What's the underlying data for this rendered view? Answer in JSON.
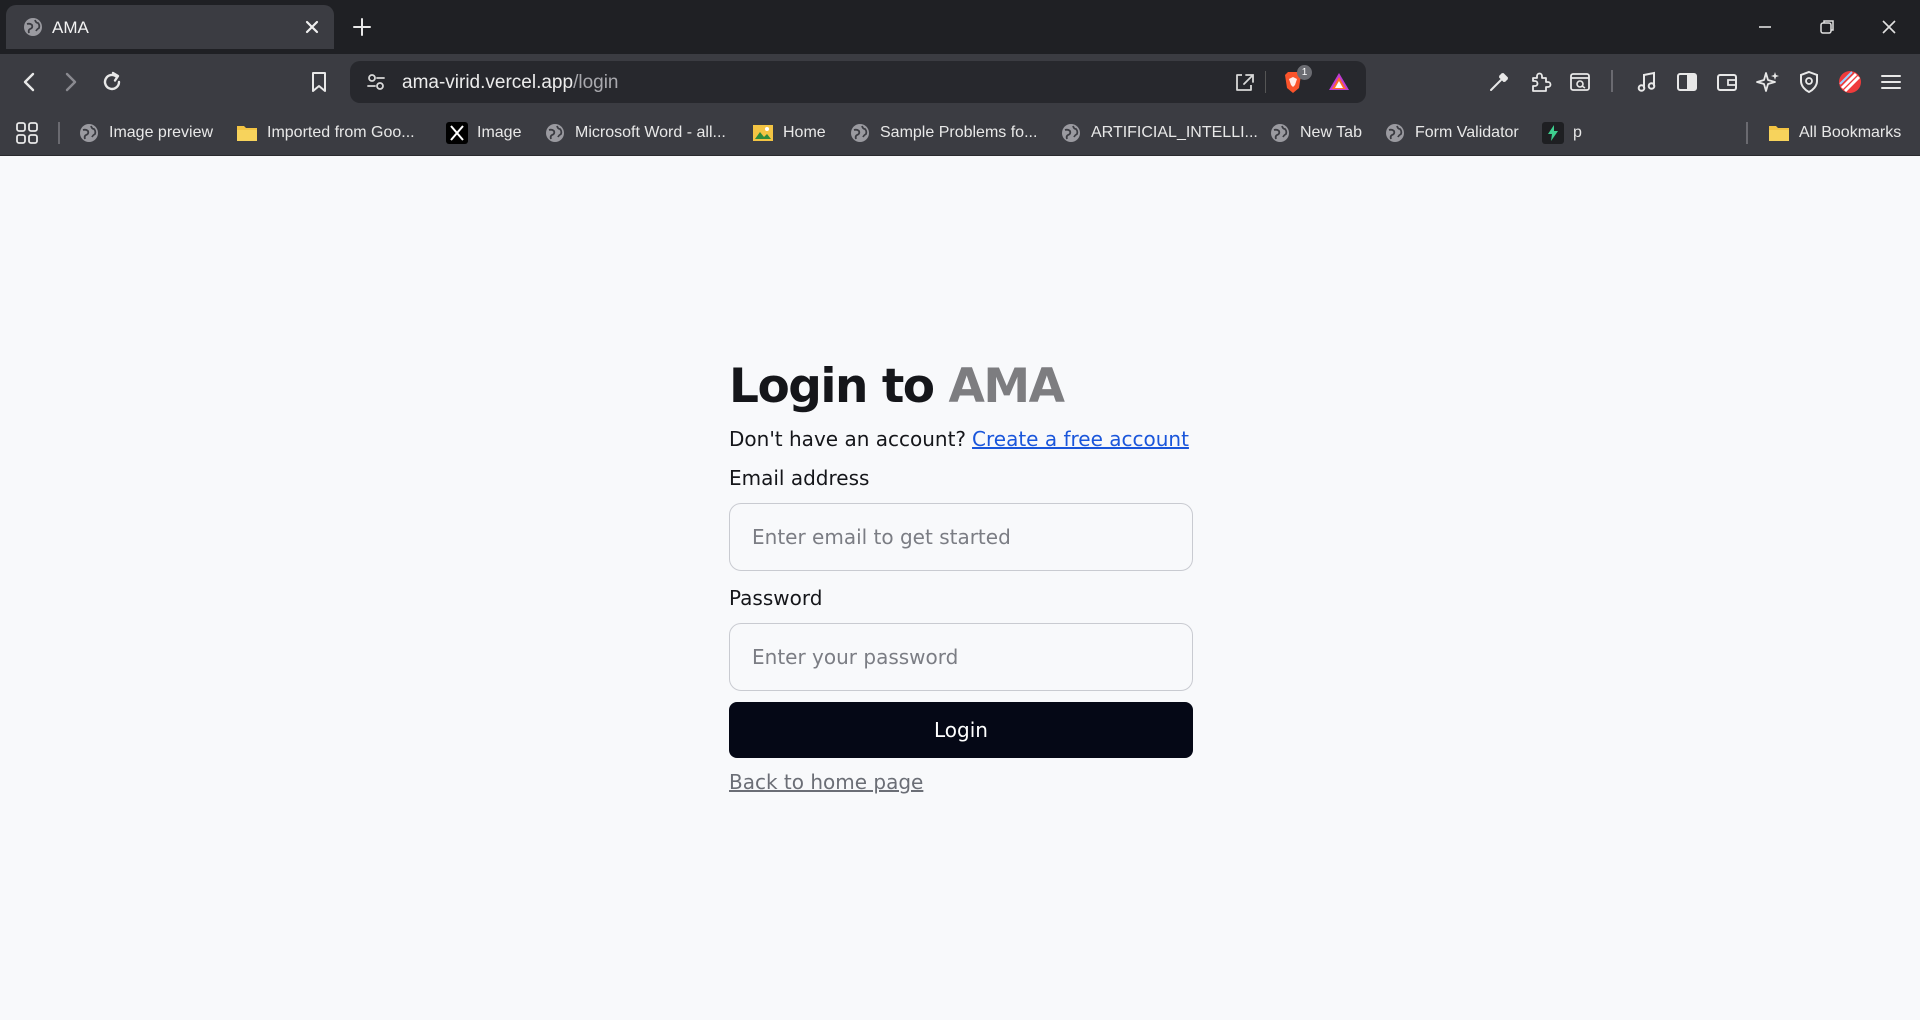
{
  "browser": {
    "tab": {
      "title": "AMA"
    },
    "address_bar": {
      "host": "ama-virid.vercel.app",
      "path": "/login"
    },
    "shields_badge": "1",
    "bookmarks": [
      {
        "label": "Image preview",
        "icon": "globe-icon"
      },
      {
        "label": "Imported from Goo...",
        "icon": "folder-icon"
      },
      {
        "label": "Image",
        "icon": "x-logo-icon"
      },
      {
        "label": "Microsoft Word - all...",
        "icon": "globe-icon"
      },
      {
        "label": "Home",
        "icon": "image-icon"
      },
      {
        "label": "Sample Problems fo...",
        "icon": "globe-icon"
      },
      {
        "label": "ARTIFICIAL_INTELLI...",
        "icon": "globe-icon"
      },
      {
        "label": "New Tab",
        "icon": "globe-icon"
      },
      {
        "label": "Form Validator",
        "icon": "globe-icon"
      },
      {
        "label": "p",
        "icon": "bolt-icon"
      }
    ],
    "all_bookmarks": "All Bookmarks"
  },
  "page": {
    "title": {
      "main": "Login to",
      "brand": "AMA"
    },
    "signup_prompt": "Don't have an account?",
    "signup_link": "Create a free account",
    "email": {
      "label": "Email address",
      "placeholder": "Enter email to get started",
      "value": ""
    },
    "password": {
      "label": "Password",
      "placeholder": "Enter your password",
      "value": ""
    },
    "login_button": "Login",
    "back_link": "Back to home page"
  },
  "colors": {
    "page_background": "#f8f9fb",
    "button_background": "#050816",
    "link": "#1a56db",
    "brand_text": "#7d7d80",
    "browser_chrome": "#3b3c42"
  }
}
